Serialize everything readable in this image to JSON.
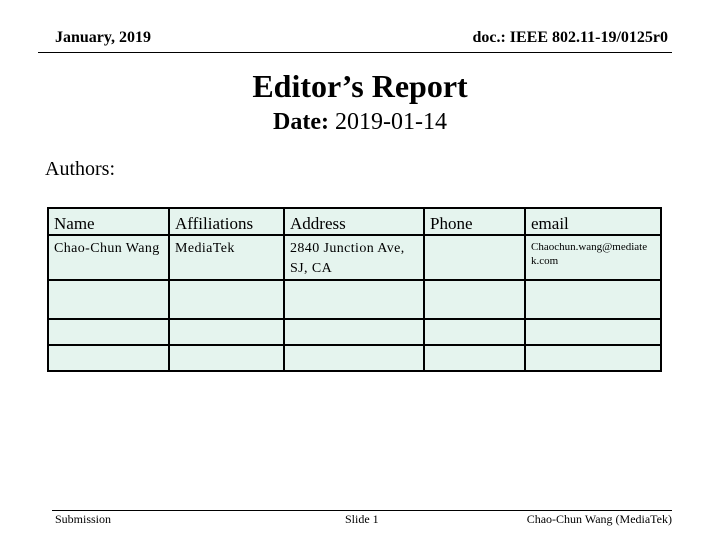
{
  "header": {
    "date": "January, 2019",
    "doc_id": "doc.: IEEE 802.11-19/0125r0"
  },
  "slide": {
    "title": "Editor’s Report",
    "date_label": "Date:",
    "date_value": " 2019-01-14",
    "authors_label": "Authors:"
  },
  "authors_table": {
    "columns": [
      "Name",
      "Affiliations",
      "Address",
      "Phone",
      "email"
    ],
    "rows": [
      [
        "Chao-Chun Wang",
        "MediaTek",
        "2840 Junction Ave, SJ, CA",
        "",
        "Chaochun.wang@mediatek.com"
      ],
      [
        "",
        "",
        "",
        "",
        ""
      ],
      [
        "",
        "",
        "",
        "",
        ""
      ],
      [
        "",
        "",
        "",
        "",
        ""
      ]
    ]
  },
  "footer": {
    "left": "Submission",
    "center": "Slide 1",
    "right": "Chao-Chun Wang (MediaTek)"
  },
  "colors": {
    "table_fill": "#e5f4ee",
    "border": "#000000"
  }
}
